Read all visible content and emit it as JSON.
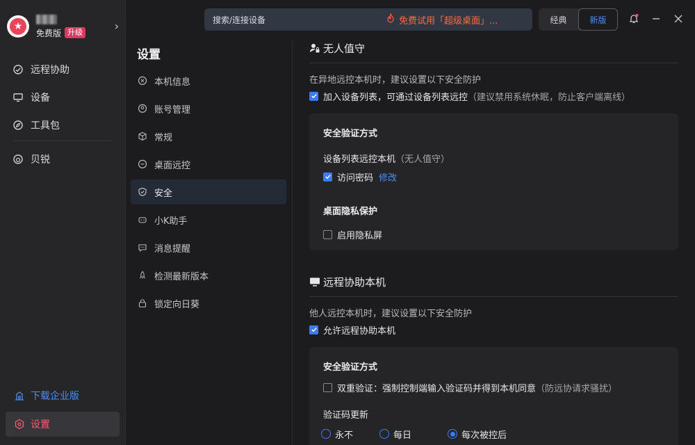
{
  "profile": {
    "plan": "免费版",
    "upgrade": "升级"
  },
  "nav": {
    "items": [
      {
        "label": "远程协助"
      },
      {
        "label": "设备"
      },
      {
        "label": "工具包"
      },
      {
        "label": "贝锐"
      }
    ],
    "download_enterprise": "下载企业版",
    "settings": "设置"
  },
  "topbar": {
    "search_label": "搜索/连接设备",
    "promo": "免费试用「超级桌面」...",
    "mode_classic": "经典",
    "mode_new": "新版"
  },
  "settings_nav": {
    "title": "设置",
    "items": [
      {
        "label": "本机信息"
      },
      {
        "label": "账号管理"
      },
      {
        "label": "常规"
      },
      {
        "label": "桌面远控"
      },
      {
        "label": "安全"
      },
      {
        "label": "小K助手"
      },
      {
        "label": "消息提醒"
      },
      {
        "label": "检测最新版本"
      },
      {
        "label": "锁定向日葵"
      }
    ]
  },
  "unattended": {
    "title": "无人值守",
    "desc": "在异地远控本机时，建议设置以下安全防护",
    "join_list": "加入设备列表，可通过设备列表远控",
    "join_hint": "（建议禁用系统休眠，防止客户端离线）",
    "verify_title": "安全验证方式",
    "device_list_remote": "设备列表远控本机",
    "device_list_hint": "（无人值守）",
    "access_password": "访问密码",
    "modify": "修改",
    "privacy_title": "桌面隐私保护",
    "privacy_screen": "启用隐私屏"
  },
  "assist": {
    "title": "远程协助本机",
    "desc": "他人远控本机时，建议设置以下安全防护",
    "allow": "允许远程协助本机",
    "verify_title": "安全验证方式",
    "dual_verify": "双重验证：强制控制端输入验证码并得到本机同意",
    "dual_hint": "（防远协请求骚扰）",
    "code_update": "验证码更新",
    "options": [
      "永不",
      "每日",
      "每次被控后"
    ]
  },
  "colors": {
    "accent": "#3b7cf2",
    "danger": "#ff5a6e",
    "promo": "#ff6b3d"
  }
}
